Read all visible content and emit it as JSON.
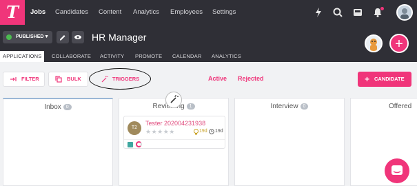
{
  "topnav": {
    "logo": "T",
    "items": [
      {
        "label": "Jobs",
        "active": true
      },
      {
        "label": "Candidates"
      },
      {
        "label": "Content"
      },
      {
        "label": "Analytics"
      },
      {
        "label": "Employees"
      },
      {
        "label": "Settings"
      }
    ],
    "icons": [
      "bolt-icon",
      "search-icon",
      "inbox-icon",
      "bell-icon",
      "user-avatar"
    ]
  },
  "job": {
    "status": "PUBLISHED",
    "title": "HR Manager",
    "tabs": [
      "APPLICATIONS",
      "COLLABORATE",
      "ACTIVITY",
      "PROMOTE",
      "CALENDAR",
      "ANALYTICS"
    ],
    "active_tab": "APPLICATIONS"
  },
  "toolbar": {
    "filter": "FILTER",
    "bulk": "BULK",
    "triggers": "TRIGGERS",
    "active": "Active",
    "rejected": "Rejected",
    "candidate": "CANDIDATE"
  },
  "board": {
    "columns": [
      {
        "name": "Inbox",
        "count": "0"
      },
      {
        "name": "Reviewing",
        "count": "1"
      },
      {
        "name": "Interview",
        "count": "0"
      },
      {
        "name": "Offered"
      }
    ],
    "card": {
      "initials": "T2",
      "name": "Tester 202004231938",
      "stars": "★★★★★",
      "days_stage": "19d",
      "days_total": "19d"
    }
  },
  "colors": {
    "accent": "#f0357a",
    "nav": "#2f2f36"
  }
}
